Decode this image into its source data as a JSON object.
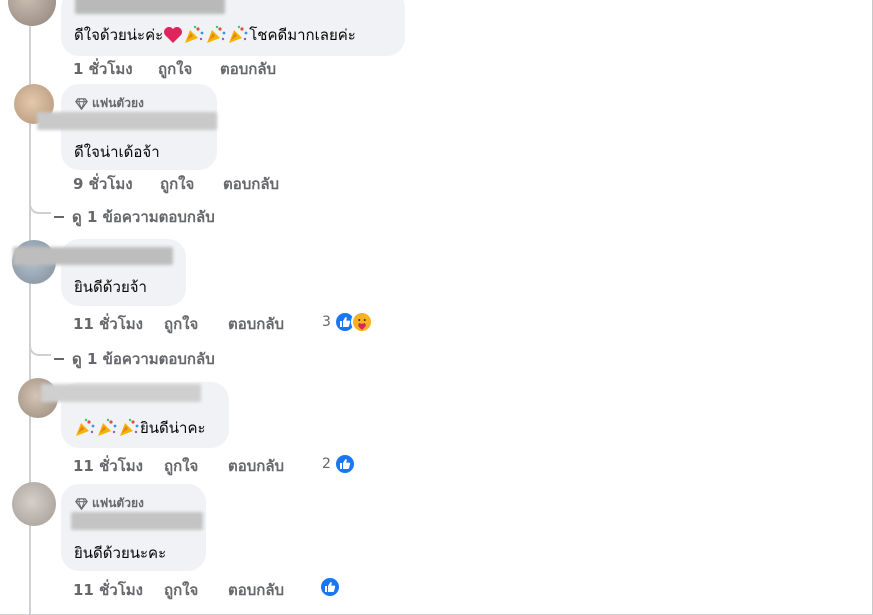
{
  "comments": [
    {
      "id": "c1",
      "name": "",
      "text_prefix": "ดีใจด้วยน่ะค่ะ",
      "text_suffix": "โชคดีมากเลยค่ะ",
      "emojis": [
        "heart",
        "party",
        "party",
        "party"
      ],
      "time": "1 ชั่วโมง",
      "like_label": "ถูกใจ",
      "reply_label": "ตอบกลับ"
    },
    {
      "id": "c2",
      "badge": "แฟนตัวยง",
      "name": "Wanya Songsomi",
      "text": "ดีใจน่าเด้อจ้า",
      "time": "9 ชั่วโมง",
      "like_label": "ถูกใจ",
      "reply_label": "ตอบกลับ",
      "view_replies": "ดู 1 ข้อความตอบกลับ"
    },
    {
      "id": "c3",
      "name": "",
      "text": "ยินดีด้วยจ้า",
      "time": "11 ชั่วโมง",
      "like_label": "ถูกใจ",
      "reply_label": "ตอบกลับ",
      "reaction_count": "3",
      "reactions": [
        "like-icon",
        "hug-icon"
      ],
      "view_replies": "ดู 1 ข้อความตอบกลับ"
    },
    {
      "id": "c4",
      "name": "",
      "text_suffix": "ยินดีน่าคะ",
      "emojis": [
        "party",
        "party",
        "party"
      ],
      "time": "11 ชั่วโมง",
      "like_label": "ถูกใจ",
      "reply_label": "ตอบกลับ",
      "reaction_count": "2",
      "reactions": [
        "like-icon"
      ]
    },
    {
      "id": "c5",
      "badge": "แฟนตัวยง",
      "name": "",
      "text": "ยินดีด้วยนะคะ",
      "time": "11 ชั่วโมง",
      "like_label": "ถูกใจ",
      "reply_label": "ตอบกลับ",
      "reactions": [
        "like-icon"
      ]
    }
  ],
  "colors": {
    "bubble": "#f0f2f5",
    "meta": "#65676b",
    "like": "#1877f2",
    "hug": "#f7b125"
  }
}
